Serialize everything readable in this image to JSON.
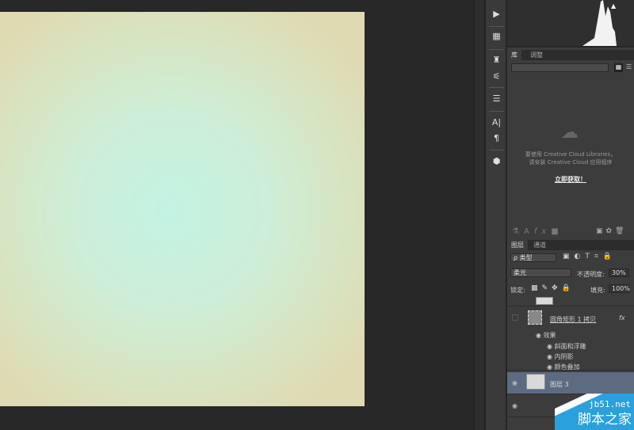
{
  "canvas": {
    "gradient_center": "#c3f3e3",
    "gradient_edge": "#dfdab2"
  },
  "toolstrip": {
    "icons": [
      "play-icon",
      "brush-preset-icon",
      "clone-source-icon",
      "tool-preset-icon",
      "layer-comp-icon",
      "character-icon",
      "paragraph-icon",
      "3d-icon"
    ]
  },
  "libraries": {
    "tabs": [
      "库",
      "调整"
    ],
    "message_line1": "要使用 Creative Cloud Libraries，",
    "message_line2": "请安装 Creative Cloud 应用程序",
    "link": "立即获取！"
  },
  "layers": {
    "tabs": [
      "图层",
      "通道"
    ],
    "filter_kind": "ρ 类型",
    "blend_mode": "柔光",
    "opacity_label": "不透明度:",
    "opacity": "30%",
    "lock_label": "锁定:",
    "fill_label": "填充:",
    "fill": "100%",
    "items": [
      {
        "name": "圆角矩形 1 拷贝",
        "fx": "fx",
        "effects_label": "效果",
        "effects": [
          "斜面和浮雕",
          "内阴影",
          "颜色叠加"
        ]
      },
      {
        "name": "图层 3"
      }
    ]
  },
  "watermark": {
    "line1": "jb51.net",
    "line2": "脚本之家"
  }
}
